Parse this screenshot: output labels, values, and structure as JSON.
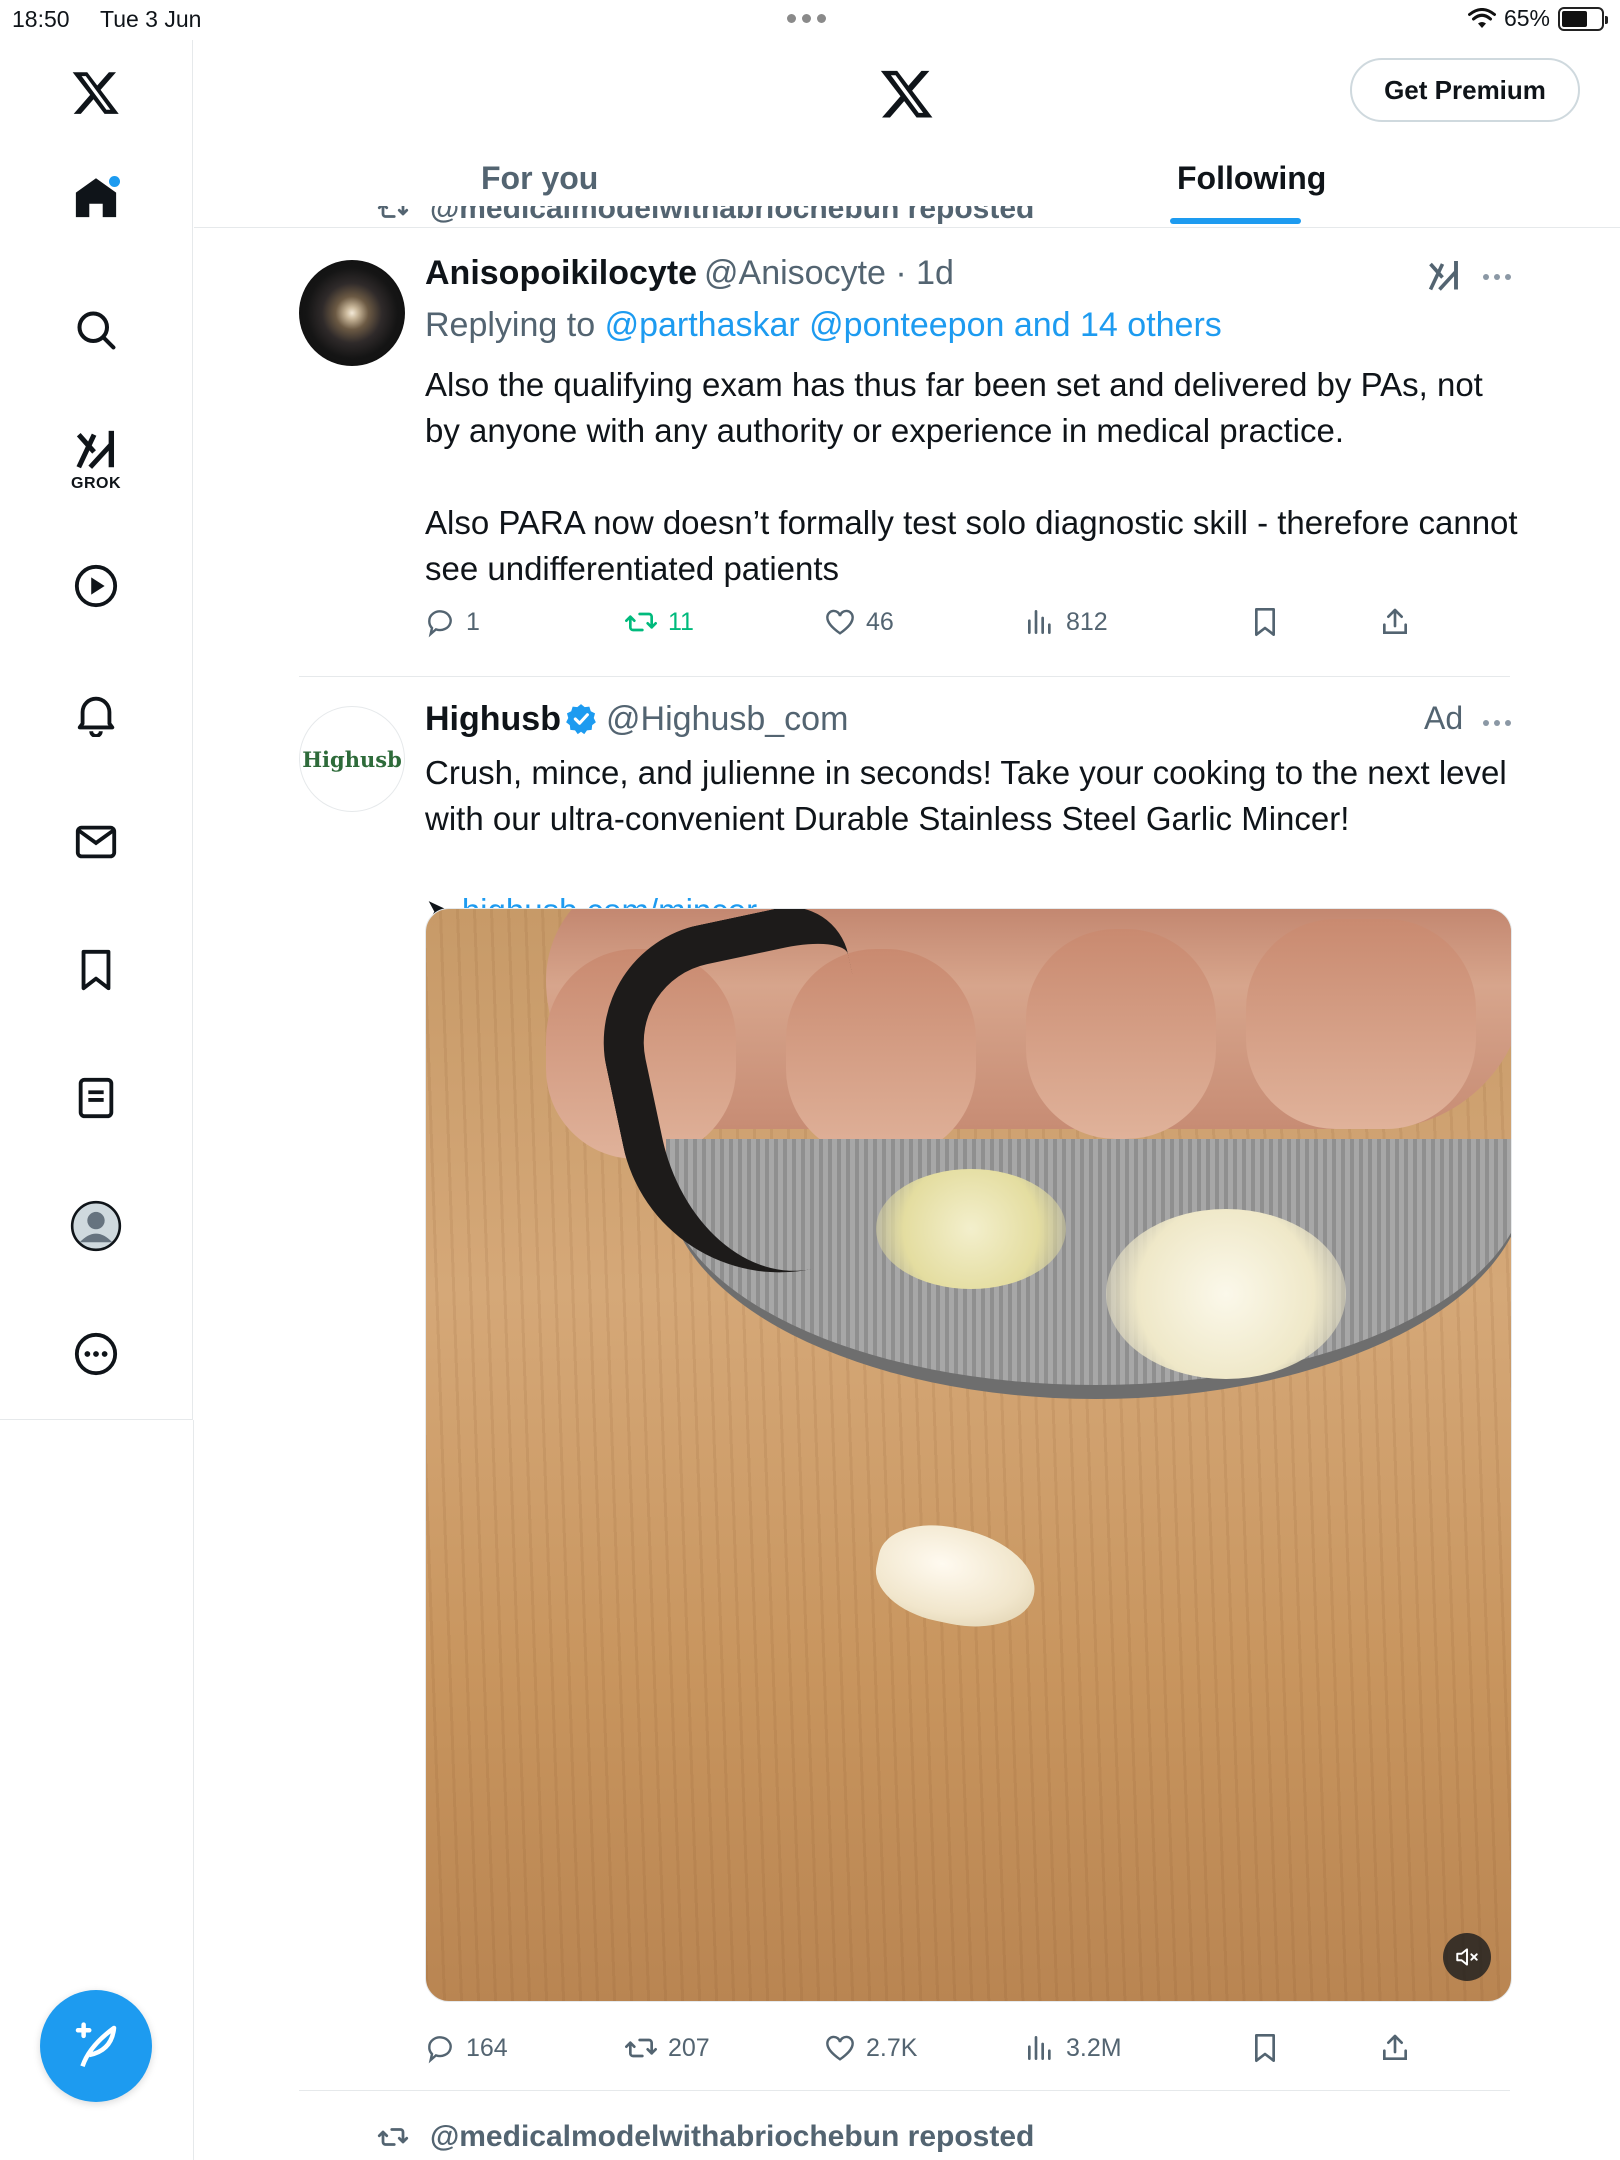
{
  "status_bar": {
    "time": "18:50",
    "date": "Tue 3 Jun",
    "battery": "65%",
    "battery_level": 0.65
  },
  "sidebar": {
    "items": [
      {
        "icon": "x-logo-icon"
      },
      {
        "icon": "home-icon",
        "has_notification_dot": true
      },
      {
        "icon": "search-icon"
      },
      {
        "icon": "grok-icon",
        "label": "GROK"
      },
      {
        "icon": "play-icon"
      },
      {
        "icon": "bell-icon"
      },
      {
        "icon": "mail-icon"
      },
      {
        "icon": "bookmark-icon"
      },
      {
        "icon": "list-icon"
      },
      {
        "icon": "profile-icon"
      },
      {
        "icon": "more-icon"
      }
    ],
    "compose_icon": "compose-feather-icon"
  },
  "header": {
    "premium_label": "Get Premium",
    "tabs": [
      {
        "label": "For you",
        "active": false
      },
      {
        "label": "Following",
        "active": true
      }
    ],
    "accent": "#1d9bf0"
  },
  "feed": {
    "top_repost_label": "@medicalmodelwithabriochebun reposted",
    "tweets": [
      {
        "name": "Anisopoikilocyte",
        "handle": "@Anisocyte",
        "time": "1d",
        "replying_prefix": "Replying to",
        "replying_to": "@parthaskar @ponteepon and 14 others",
        "text": "Also the qualifying exam has thus far been set and delivered by PAs, not by anyone with any authority or experience in medical practice.\n\nAlso PARA now doesn’t formally test solo diagnostic skill - therefore cannot see undifferentiated patients",
        "replies": "1",
        "reposts": "11",
        "likes": "46",
        "views": "812"
      },
      {
        "name": "Highusb",
        "handle": "@Highusb_com",
        "avatar_text": "Highusb",
        "ad_label": "Ad",
        "text": "Crush, mince, and julienne in seconds!  Take your cooking to the next level with our ultra-convenient Durable Stainless Steel Garlic Mincer!",
        "link_prefix": "➤",
        "link": "highusb.com/mincer",
        "replies": "164",
        "reposts": "207",
        "likes": "2.7K",
        "views": "3.2M"
      }
    ],
    "bottom_repost_label": "@medicalmodelwithabriochebun reposted"
  }
}
